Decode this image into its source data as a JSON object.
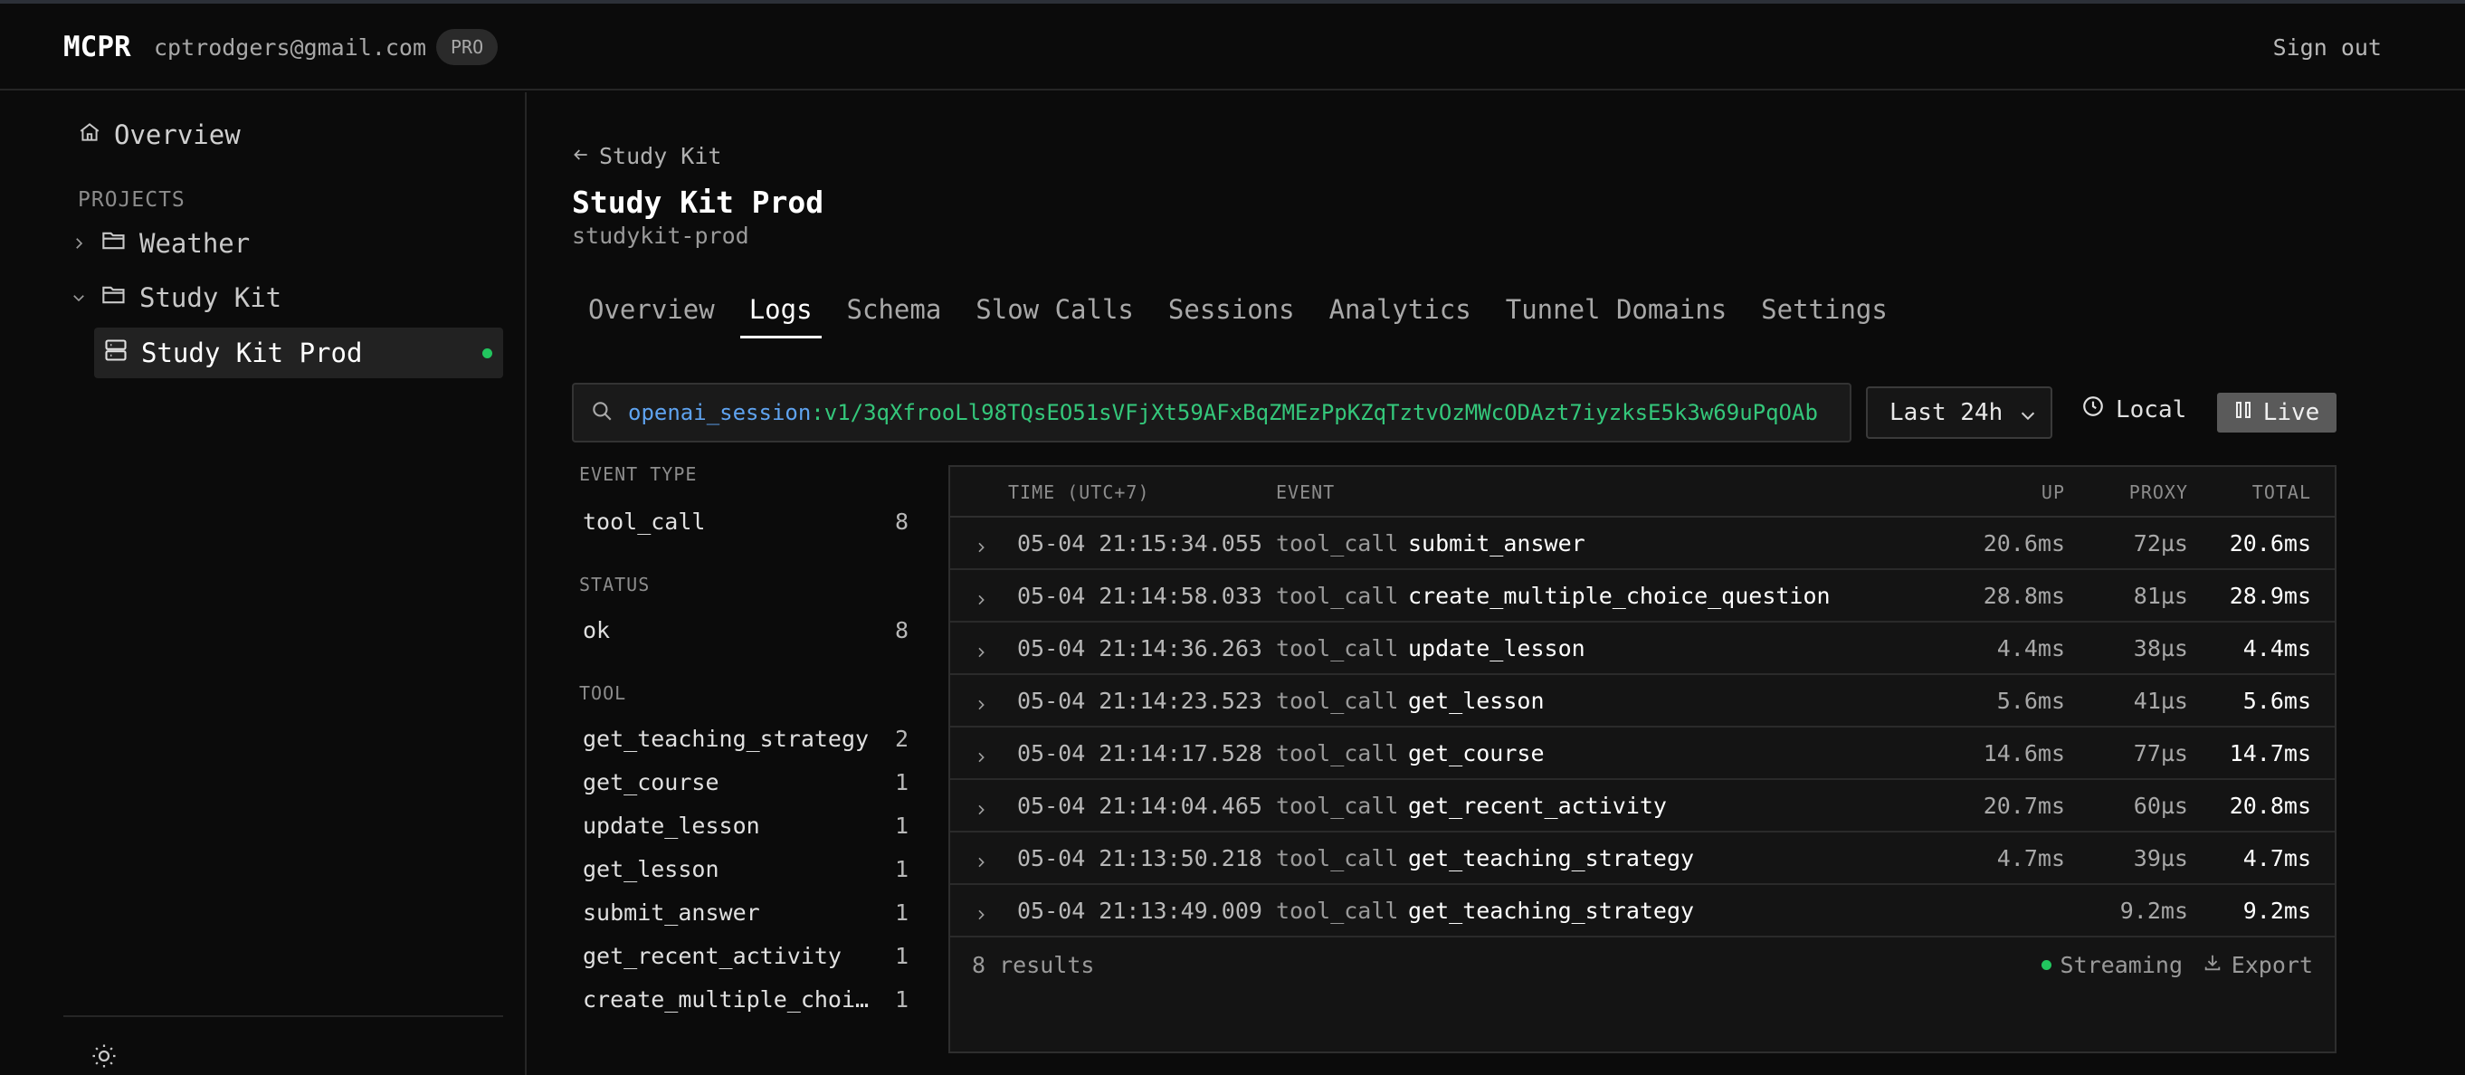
{
  "header": {
    "brand": "MCPR",
    "email": "cptrodgers@gmail.com",
    "badge": "PRO",
    "sign_out": "Sign out"
  },
  "sidebar": {
    "overview": "Overview",
    "projects_label": "PROJECTS",
    "projects": [
      {
        "name": "Weather",
        "expanded": false
      },
      {
        "name": "Study Kit",
        "expanded": true
      }
    ],
    "active_item": "Study Kit Prod",
    "icons": [
      "home-icon",
      "folder-icon",
      "server-icon",
      "sun-icon"
    ]
  },
  "page": {
    "back": "Study Kit",
    "title": "Study Kit Prod",
    "slug": "studykit-prod"
  },
  "tabs": [
    "Overview",
    "Logs",
    "Schema",
    "Slow Calls",
    "Sessions",
    "Analytics",
    "Tunnel Domains",
    "Settings"
  ],
  "active_tab": "Logs",
  "search": {
    "key": "openai_session",
    "separator": ":",
    "value": "v1/3qXfrooLl98TQsEO51sVFjXt59AFxBqZMEzPpKZqTztvOzMWcODAzt7iyzksE5k3w69uPqOAb"
  },
  "controls": {
    "range": "Last 24h",
    "timezone": "Local",
    "live": "Live"
  },
  "filters": {
    "event_type_label": "EVENT TYPE",
    "event_types": [
      {
        "name": "tool_call",
        "count": "8"
      }
    ],
    "status_label": "STATUS",
    "statuses": [
      {
        "name": "ok",
        "count": "8"
      }
    ],
    "tool_label": "TOOL",
    "tools": [
      {
        "name": "get_teaching_strategy",
        "count": "2"
      },
      {
        "name": "get_course",
        "count": "1"
      },
      {
        "name": "update_lesson",
        "count": "1"
      },
      {
        "name": "get_lesson",
        "count": "1"
      },
      {
        "name": "submit_answer",
        "count": "1"
      },
      {
        "name": "get_recent_activity",
        "count": "1"
      },
      {
        "name": "create_multiple_choic…",
        "count": "1"
      }
    ]
  },
  "table": {
    "columns": {
      "time": "TIME (UTC+7)",
      "event": "EVENT",
      "up": "UP",
      "proxy": "PROXY",
      "total": "TOTAL"
    },
    "rows": [
      {
        "time": "05-04 21:15:34.055",
        "type": "tool_call",
        "name": "submit_answer",
        "up": "20.6ms",
        "proxy": "72µs",
        "total": "20.6ms"
      },
      {
        "time": "05-04 21:14:58.033",
        "type": "tool_call",
        "name": "create_multiple_choice_question",
        "up": "28.8ms",
        "proxy": "81µs",
        "total": "28.9ms"
      },
      {
        "time": "05-04 21:14:36.263",
        "type": "tool_call",
        "name": "update_lesson",
        "up": "4.4ms",
        "proxy": "38µs",
        "total": "4.4ms"
      },
      {
        "time": "05-04 21:14:23.523",
        "type": "tool_call",
        "name": "get_lesson",
        "up": "5.6ms",
        "proxy": "41µs",
        "total": "5.6ms"
      },
      {
        "time": "05-04 21:14:17.528",
        "type": "tool_call",
        "name": "get_course",
        "up": "14.6ms",
        "proxy": "77µs",
        "total": "14.7ms"
      },
      {
        "time": "05-04 21:14:04.465",
        "type": "tool_call",
        "name": "get_recent_activity",
        "up": "20.7ms",
        "proxy": "60µs",
        "total": "20.8ms"
      },
      {
        "time": "05-04 21:13:50.218",
        "type": "tool_call",
        "name": "get_teaching_strategy",
        "up": "4.7ms",
        "proxy": "39µs",
        "total": "4.7ms"
      },
      {
        "time": "05-04 21:13:49.009",
        "type": "tool_call",
        "name": "get_teaching_strategy",
        "up": "",
        "proxy": "9.2ms",
        "total": "9.2ms"
      }
    ],
    "results": "8 results",
    "streaming": "Streaming",
    "export": "Export"
  },
  "colors": {
    "accent_green": "#22c55e",
    "search_key": "#5fa3f0",
    "search_value": "#34c77b",
    "background": "#0b0b0b"
  }
}
